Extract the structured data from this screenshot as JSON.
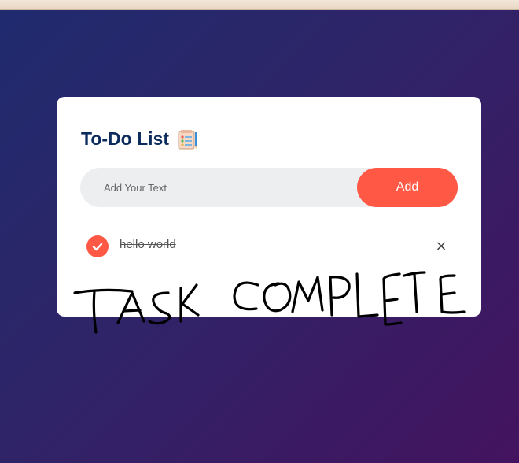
{
  "app": {
    "title": "To-Do List",
    "title_icon": "notepad-icon"
  },
  "input": {
    "placeholder": "Add Your Text",
    "value": ""
  },
  "add_button": {
    "label": "Add"
  },
  "tasks": [
    {
      "text": "hello world",
      "completed": true,
      "delete_label": "×"
    }
  ],
  "annotation": {
    "handwritten_text": "TASK COMPLETE"
  },
  "colors": {
    "accent": "#ff5945",
    "title": "#0d2c5e",
    "input_bg": "#edeef0",
    "card": "#ffffff",
    "bg_start": "#1f2b6e",
    "bg_end": "#44135f"
  }
}
